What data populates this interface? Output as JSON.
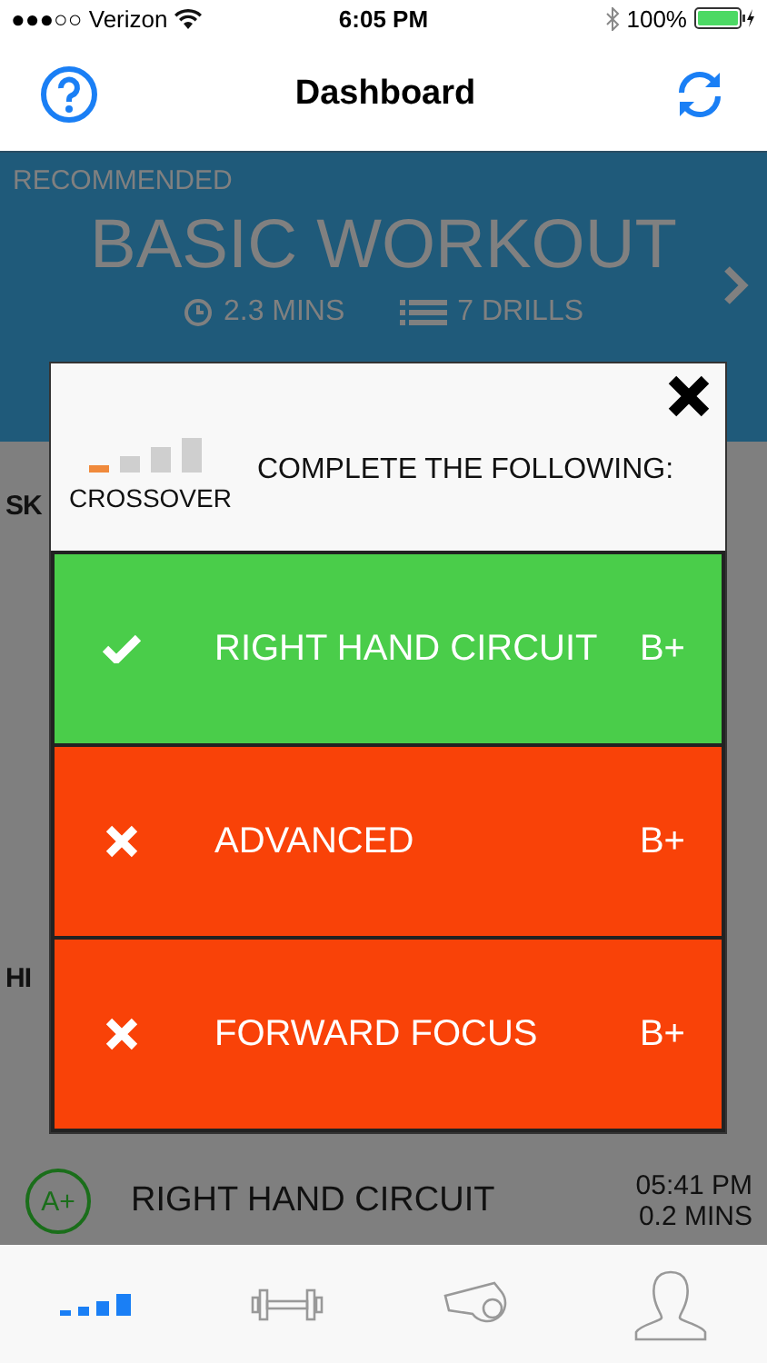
{
  "status_bar": {
    "carrier": "●●●○○ Verizon",
    "time": "6:05 PM",
    "battery": "100%"
  },
  "nav": {
    "title": "Dashboard"
  },
  "recommended": {
    "label": "RECOMMENDED",
    "title": "BASIC WORKOUT",
    "duration": "2.3 MINS",
    "drills": "7 DRILLS"
  },
  "skills": {
    "heading": "SK"
  },
  "history": {
    "heading": "HI",
    "entries": [
      {
        "grade": "A+",
        "name": "RIGHT HAND CIRCUIT",
        "time": "05:41 PM",
        "duration": "0.2 MINS"
      }
    ]
  },
  "modal": {
    "skill": "CROSSOVER",
    "level": 0.25,
    "title": "COMPLETE THE FOLLOWING:",
    "tasks": [
      {
        "name": "RIGHT HAND CIRCUIT",
        "grade": "B+",
        "completed": true
      },
      {
        "name": "ADVANCED",
        "grade": "B+",
        "completed": false
      },
      {
        "name": "FORWARD FOCUS",
        "grade": "B+",
        "completed": false
      }
    ]
  },
  "tab_bar": {
    "tabs": [
      {
        "kind": "progress",
        "selected": true
      },
      {
        "kind": "workout",
        "selected": false
      },
      {
        "kind": "coach",
        "selected": false
      },
      {
        "kind": "profile",
        "selected": false
      }
    ]
  }
}
